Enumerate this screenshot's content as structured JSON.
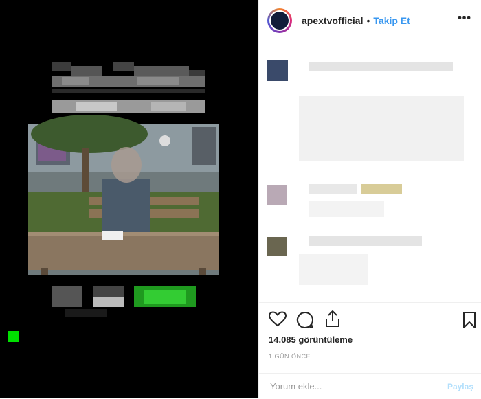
{
  "post": {
    "username": "apextvofficial",
    "separator": "•",
    "follow_label": "Takip Et",
    "more_label": "•••",
    "views_text": "14.085 görüntüleme",
    "time_text": "1 GÜN ÖNCE",
    "comment_placeholder": "Yorum ekle...",
    "share_label": "Paylaş"
  },
  "icons": {
    "like": "heart-icon",
    "comment": "comment-icon",
    "share": "share-icon",
    "save": "bookmark-icon",
    "more": "more-options-icon"
  },
  "colors": {
    "accent": "#3897f0",
    "share_disabled": "#b2dffc",
    "media_background": "#000000",
    "recording_indicator": "#00e000"
  }
}
